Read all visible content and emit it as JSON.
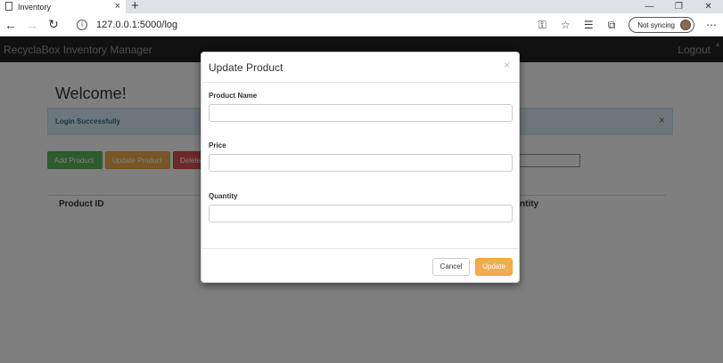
{
  "browser": {
    "tab_title": "Inventory",
    "tab_close": "×",
    "new_tab": "+",
    "url": "127.0.0.1:5000/log",
    "sync_label": "Not syncing",
    "win_min": "—",
    "win_restore": "❐",
    "win_close": "✕"
  },
  "navbar": {
    "brand": "RecyclaBox Inventory Manager",
    "logout": "Logout"
  },
  "page": {
    "welcome": "Welcome!",
    "alert_text": "Login Successfully",
    "alert_close": "×",
    "buttons": {
      "add": "Add Product",
      "update": "Update Product",
      "delete": "Delete"
    },
    "table_headers": {
      "product_id": "Product ID",
      "quantity": "ntity"
    }
  },
  "modal": {
    "title": "Update Product",
    "close": "×",
    "fields": [
      {
        "label": "Product Name",
        "value": "",
        "placeholder": ""
      },
      {
        "label": "Price",
        "value": "",
        "placeholder": ""
      },
      {
        "label": "Quantity",
        "value": "",
        "placeholder": ""
      }
    ],
    "cancel_label": "Cancel",
    "update_label": "Update"
  },
  "colors": {
    "success": "#5cb85c",
    "warning": "#f0ad4e",
    "danger": "#d9534f",
    "info_bg": "#d9edf7",
    "navbar": "#222222"
  },
  "icons": [
    "document-icon",
    "back-icon",
    "forward-icon",
    "refresh-icon",
    "info-icon",
    "key-icon",
    "star-icon",
    "favorites-icon",
    "collections-icon",
    "avatar",
    "more-icon"
  ]
}
